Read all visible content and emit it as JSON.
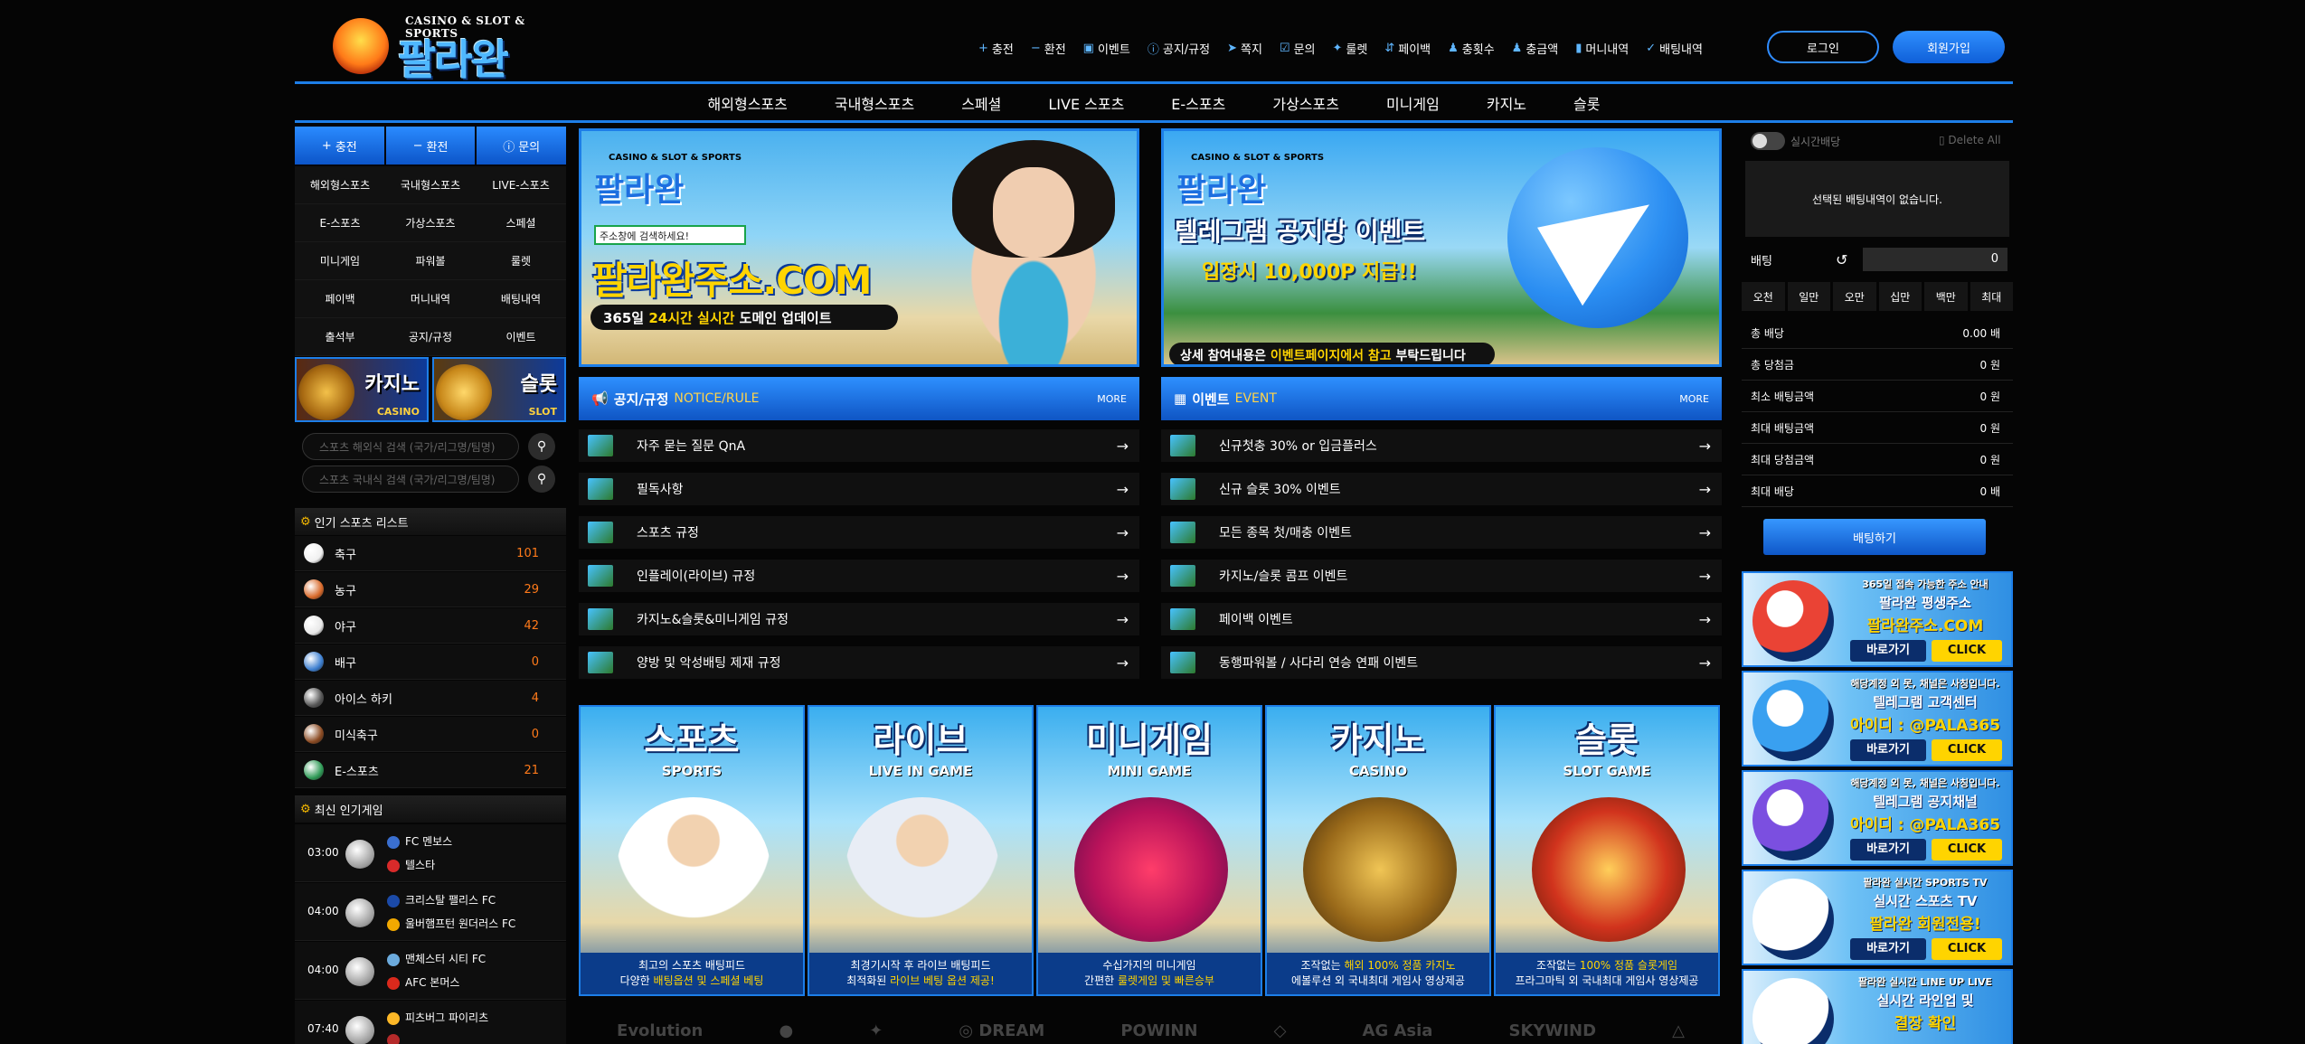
{
  "header": {
    "logo_sup": "CASINO & SLOT & SPORTS",
    "logo_text": "팔라완",
    "topnav": [
      {
        "icon": "plus-icon",
        "glyph": "+",
        "label": "충전"
      },
      {
        "icon": "minus-icon",
        "glyph": "−",
        "label": "환전"
      },
      {
        "icon": "calendar-icon",
        "glyph": "▣",
        "label": "이벤트"
      },
      {
        "icon": "info-icon",
        "glyph": "ⓘ",
        "label": "공지/규정"
      },
      {
        "icon": "send-icon",
        "glyph": "➤",
        "label": "쪽지"
      },
      {
        "icon": "checkbox-icon",
        "glyph": "☑",
        "label": "문의"
      },
      {
        "icon": "gift-icon",
        "glyph": "✦",
        "label": "룰렛"
      },
      {
        "icon": "payback-icon",
        "glyph": "⇵",
        "label": "페이백"
      },
      {
        "icon": "user-icon",
        "glyph": "♟",
        "label": "충횟수"
      },
      {
        "icon": "user-money-icon",
        "glyph": "♟",
        "label": "충금액"
      },
      {
        "icon": "document-icon",
        "glyph": "▮",
        "label": "머니내역"
      },
      {
        "icon": "check-icon",
        "glyph": "✓",
        "label": "배팅내역"
      }
    ],
    "login": "로그인",
    "join": "회원가입"
  },
  "mainnav": [
    "해외형스포츠",
    "국내형스포츠",
    "스페셜",
    "LIVE 스포츠",
    "E-스포츠",
    "가상스포츠",
    "미니게임",
    "카지노",
    "슬롯"
  ],
  "left": {
    "quick": [
      {
        "glyph": "+",
        "label": "충전"
      },
      {
        "glyph": "−",
        "label": "환전"
      },
      {
        "glyph": "ⓘ",
        "label": "문의"
      }
    ],
    "menu": [
      "해외형스포츠",
      "국내형스포츠",
      "LIVE-스포츠",
      "E-스포츠",
      "가상스포츠",
      "스페셜",
      "미니게임",
      "파워볼",
      "룰렛",
      "페이백",
      "머니내역",
      "배팅내역",
      "출석부",
      "공지/규정",
      "이벤트"
    ],
    "promo_casino": {
      "title": "카지노",
      "sub": "CASINO"
    },
    "promo_slot": {
      "title": "슬롯",
      "sub": "SLOT"
    },
    "search1": "스포츠 해외식 검색 (국가/리그명/팀명)",
    "search2": "스포츠 국내식 검색 (국가/리그명/팀명)",
    "popular_title": "인기 스포츠 리스트",
    "sports": [
      {
        "name": "축구",
        "count": "101",
        "color": "#f0f0f0"
      },
      {
        "name": "농구",
        "count": "29",
        "color": "#d8692a"
      },
      {
        "name": "야구",
        "count": "42",
        "color": "#e8e8e8"
      },
      {
        "name": "배구",
        "count": "0",
        "color": "#3d7fd0"
      },
      {
        "name": "아이스 하키",
        "count": "4",
        "color": "#555555"
      },
      {
        "name": "미식축구",
        "count": "0",
        "color": "#8a4a22"
      },
      {
        "name": "E-스포츠",
        "count": "21",
        "color": "#2f9b57"
      }
    ],
    "recent_title": "최신 인기게임",
    "games": [
      {
        "time": "03:00",
        "home": "FC 멘보스",
        "away": "텔스타",
        "hc": "#3a6fd0",
        "ac": "#d82a2a"
      },
      {
        "time": "04:00",
        "home": "크리스탈 팰리스 FC",
        "away": "울버햄프턴 원더러스 FC",
        "hc": "#1b4aa8",
        "ac": "#f2a900"
      },
      {
        "time": "04:00",
        "home": "맨체스터 시티 FC",
        "away": "AFC 본머스",
        "hc": "#6cabdd",
        "ac": "#da291c"
      },
      {
        "time": "07:40",
        "home": "피츠버그 파이리츠",
        "away": "",
        "hc": "#fdb827",
        "ac": "#b52a2a"
      }
    ]
  },
  "banners": {
    "b1": {
      "sup": "CASINO & SLOT & SPORTS",
      "logo": "팔라완",
      "search": "주소창에 검색하세요!",
      "domain": "팔라완주소.COM",
      "strip_a": "365일 ",
      "strip_b": "24시간 실시간",
      "strip_c": " 도메인 업데이트"
    },
    "b2": {
      "sup": "CASINO & SLOT & SPORTS",
      "logo": "팔라완",
      "title": "텔레그램 공지방 이벤트",
      "sub": "입장시 10,000P 지급!!",
      "strip_a": "상세 참여내용은 ",
      "strip_b": "이벤트페이지에서 참고",
      "strip_c": " 부탁드립니다"
    }
  },
  "notice": {
    "title": "공지/규정",
    "sub": "NOTICE/RULE",
    "more": "MORE",
    "items": [
      "자주 묻는 질문 QnA",
      "필독사항",
      "스포츠 규정",
      "인플레이(라이브) 규정",
      "카지노&슬롯&미니게임 규정",
      "양방 및 악성배팅 제재 규정"
    ]
  },
  "event": {
    "title": "이벤트",
    "sub": "EVENT",
    "more": "MORE",
    "items": [
      "신규첫충 30% or 입금플러스",
      "신규 슬롯 30% 이벤트",
      "모든 종목 첫/매충 이벤트",
      "카지노/슬롯 콤프 이벤트",
      "페이백 이벤트",
      "동행파워볼 / 사다리 연승 연패 이벤트"
    ]
  },
  "tiles": [
    {
      "title": "스포츠",
      "en": "SPORTS",
      "c1": "최고의 스포츠 배팅피드",
      "c2a": "다양한 ",
      "c2b": "배팅옵션 및 스페셜 베팅",
      "c2c": ""
    },
    {
      "title": "라이브",
      "en": "LIVE IN GAME",
      "c1": "최경기시작 후 라이브 배팅피드",
      "c2a": "최적화된 ",
      "c2b": "라이브 베팅 옵션 제공!",
      "c2c": ""
    },
    {
      "title": "미니게임",
      "en": "MINI GAME",
      "c1": "수십가지의 미니게임",
      "c2a": "간편한 ",
      "c2b": "룰렛게임 및 빠른승부",
      "c2c": ""
    },
    {
      "title": "카지노",
      "en": "CASINO",
      "c1a": "조작없는 ",
      "c1b": "해외 100% 정품 카지노",
      "c2a": "에볼루션 외 국내최대 게임사 영상제공",
      "c2b": "",
      "c2c": ""
    },
    {
      "title": "슬롯",
      "en": "SLOT GAME",
      "c1a": "조작없는 ",
      "c1b": "100% 정품 슬롯게임",
      "c2a": "프라그마틱 외 국내최대 게임사 영상제공",
      "c2b": "",
      "c2c": ""
    }
  ],
  "providers": [
    "Evolution",
    "●",
    "✦",
    "◎ DREAM",
    "POWINN",
    "◇",
    "AG Asia",
    "SKYWIND",
    "△"
  ],
  "right": {
    "live_label": "실시간배당",
    "delete_all": "Delete All",
    "empty": "선택된 배팅내역이 없습니다.",
    "bet_label": "배팅",
    "bet_value": "0",
    "chips": [
      "오천",
      "일만",
      "오만",
      "십만",
      "백만",
      "최대"
    ],
    "summary": [
      {
        "k": "총 배당",
        "v": "0.00 배"
      },
      {
        "k": "총 당첨금",
        "v": "0 원"
      },
      {
        "k": "최소 배팅금액",
        "v": "0 원"
      },
      {
        "k": "최대 배팅금액",
        "v": "0 원"
      },
      {
        "k": "최대 당첨금액",
        "v": "0 원"
      },
      {
        "k": "최대 배당",
        "v": "0 배"
      }
    ],
    "bet_button": "배팅하기",
    "ads": [
      {
        "l1": "365일 접속 가능한 주소 안내",
        "l2": "팔라완 평생주소",
        "l3": "팔라완주소.COM",
        "go": "바로가기",
        "click": "CLICK",
        "ic": "#ea4335"
      },
      {
        "l1": "해당계정 외 못, 채널은 사칭입니다.",
        "l2": "텔레그램 고객센터",
        "l3": "아이디 : @PALA365",
        "go": "바로가기",
        "click": "CLICK",
        "ic": "#39a0f0"
      },
      {
        "l1": "해당계정 외 못, 채널은 사칭입니다.",
        "l2": "텔레그램 공지채널",
        "l3": "아이디 : @PALA365",
        "go": "바로가기",
        "click": "CLICK",
        "ic": "#7b4fe0"
      },
      {
        "l1": "팔라완 실시간 SPORTS TV",
        "l2": "실시간 스포츠 TV",
        "l3": "팔라완 회원전용!",
        "go": "바로가기",
        "click": "CLICK",
        "ic": "#ffffff"
      },
      {
        "l1": "팔라완 실시간 LINE UP LIVE",
        "l2": "실시간 라인업 및",
        "l3": "결장 확인",
        "go": "",
        "click": "",
        "ic": "#ffffff"
      }
    ]
  }
}
